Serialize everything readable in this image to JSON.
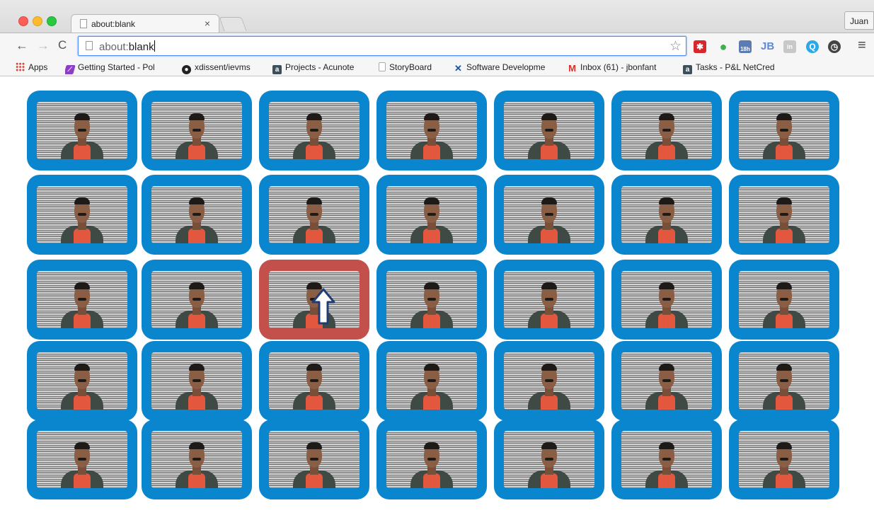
{
  "window": {
    "profile_name": "Juan"
  },
  "tabs": [
    {
      "title": "about:blank",
      "close": "×"
    }
  ],
  "toolbar": {
    "back": "←",
    "forward": "→",
    "reload": "C",
    "address_scheme": "about:",
    "address_path": "blank",
    "star": "☆",
    "menu": "≡",
    "extensions": [
      {
        "name": "red-asterisk-extension-icon",
        "glyph": "✱"
      },
      {
        "name": "evernote-extension-icon",
        "glyph": "●"
      },
      {
        "name": "calendar-extension-icon",
        "glyph": "18h"
      },
      {
        "name": "jetbrains-extension-icon",
        "glyph": "JB"
      },
      {
        "name": "linkedin-extension-icon",
        "glyph": "in"
      },
      {
        "name": "search-extension-icon",
        "glyph": "Q"
      },
      {
        "name": "clock-extension-icon",
        "glyph": "◷"
      }
    ]
  },
  "bookmarks": [
    {
      "label": "Apps",
      "icon": "apps-grid-icon",
      "color": "#e04436"
    },
    {
      "label": "Getting Started - Pol",
      "icon": "polymer-icon",
      "color": "#8b3fc7"
    },
    {
      "label": "xdissent/ievms",
      "icon": "github-icon",
      "color": "#222222"
    },
    {
      "label": "Projects - Acunote",
      "icon": "acunote-icon",
      "color": "#3c4f5c"
    },
    {
      "label": "StoryBoard",
      "icon": "page-icon",
      "color": "#ffffff"
    },
    {
      "label": "Software Developme",
      "icon": "x-logo-icon",
      "color": "#1b4f9c"
    },
    {
      "label": "Inbox (61) - jbonfant",
      "icon": "gmail-icon",
      "color": "#d93025"
    },
    {
      "label": "Tasks - P&L NetCred",
      "icon": "acunote-icon",
      "color": "#3c4f5c"
    }
  ],
  "content": {
    "grid_rows": 5,
    "grid_cols": 7,
    "active_tile": {
      "row": 2,
      "col": 2
    },
    "tile_color": "#0a86cf",
    "active_tile_color": "#c4504c",
    "active_tile_icon": "up-arrow-icon"
  }
}
